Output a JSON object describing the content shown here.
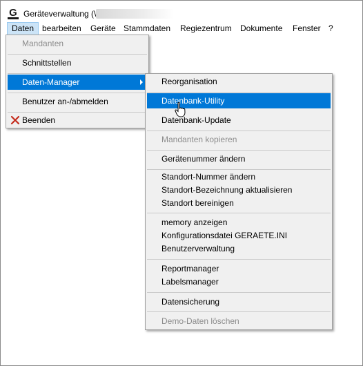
{
  "window": {
    "title": "Geräteverwaltung (\\"
  },
  "menubar": {
    "items": [
      {
        "label": "Daten"
      },
      {
        "label": "bearbeiten"
      },
      {
        "label": "Geräte"
      },
      {
        "label": "Stammdaten"
      },
      {
        "label": "Regiezentrum"
      },
      {
        "label": "Dokumente"
      },
      {
        "label": "Fenster"
      },
      {
        "label": "?"
      }
    ]
  },
  "daten_menu": {
    "items": [
      {
        "label": "Mandanten",
        "state": "disabled"
      },
      {
        "label": "Schnittstellen",
        "state": "enabled"
      },
      {
        "label": "Daten-Manager",
        "state": "highlighted",
        "has_submenu": true
      },
      {
        "label": "Benutzer an-/abmelden",
        "state": "enabled"
      },
      {
        "label": "Beenden",
        "state": "enabled",
        "icon": "close-x-icon"
      }
    ]
  },
  "datenmanager_submenu": {
    "items": [
      {
        "label": "Reorganisation",
        "state": "enabled"
      },
      {
        "label": "Datenbank-Utility",
        "state": "highlighted"
      },
      {
        "label": "Datenbank-Update",
        "state": "enabled"
      },
      {
        "label": "Mandanten kopieren",
        "state": "disabled"
      },
      {
        "label": "Gerätenummer ändern",
        "state": "enabled"
      },
      {
        "label": "Standort-Nummer ändern",
        "state": "enabled"
      },
      {
        "label": "Standort-Bezeichnung aktualisieren",
        "state": "enabled"
      },
      {
        "label": "Standort bereinigen",
        "state": "enabled"
      },
      {
        "label": "memory anzeigen",
        "state": "enabled"
      },
      {
        "label": "Konfigurationsdatei GERAETE.INI",
        "state": "enabled"
      },
      {
        "label": "Benutzerverwaltung",
        "state": "enabled"
      },
      {
        "label": "Reportmanager",
        "state": "enabled"
      },
      {
        "label": "Labelsmanager",
        "state": "enabled"
      },
      {
        "label": "Datensicherung",
        "state": "enabled"
      },
      {
        "label": "Demo-Daten löschen",
        "state": "disabled"
      }
    ]
  },
  "colors": {
    "highlight": "#0078d7",
    "menubar_active": "#cce4f7",
    "menu_background": "#f0f0f0",
    "disabled_text": "#8c8c8c",
    "close_icon": "#c42b1c"
  }
}
